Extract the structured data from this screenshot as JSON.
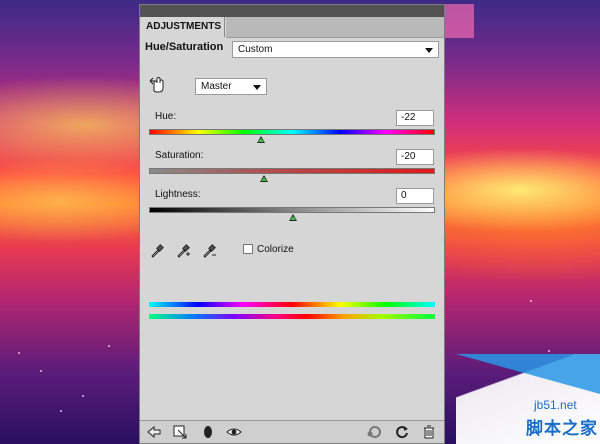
{
  "panel": {
    "tab_label": "ADJUSTMENTS",
    "title": "Hue/Saturation",
    "preset_value": "Custom",
    "channel_value": "Master",
    "hue": {
      "label": "Hue:",
      "value": "-22",
      "position": 0.439
    },
    "saturation": {
      "label": "Saturation:",
      "value": "-20",
      "position": 0.4
    },
    "lightness": {
      "label": "Lightness:",
      "value": "0",
      "position": 0.5
    },
    "colorize_label": "Colorize",
    "colorize_checked": false
  },
  "bottom_icons": [
    "back-arrow-icon",
    "clip-to-layer-icon",
    "visibility-mask-icon",
    "eye-icon",
    "previous-state-icon",
    "reset-icon",
    "trash-icon"
  ],
  "watermark": {
    "url": "jb51.net",
    "chinese": "脚本之家"
  },
  "colors": {
    "panel_bg": "#d6d6d6",
    "top_bar": "#535353",
    "accent_green": "#3fbf3f",
    "watermark_blue": "#1a6ec8"
  }
}
